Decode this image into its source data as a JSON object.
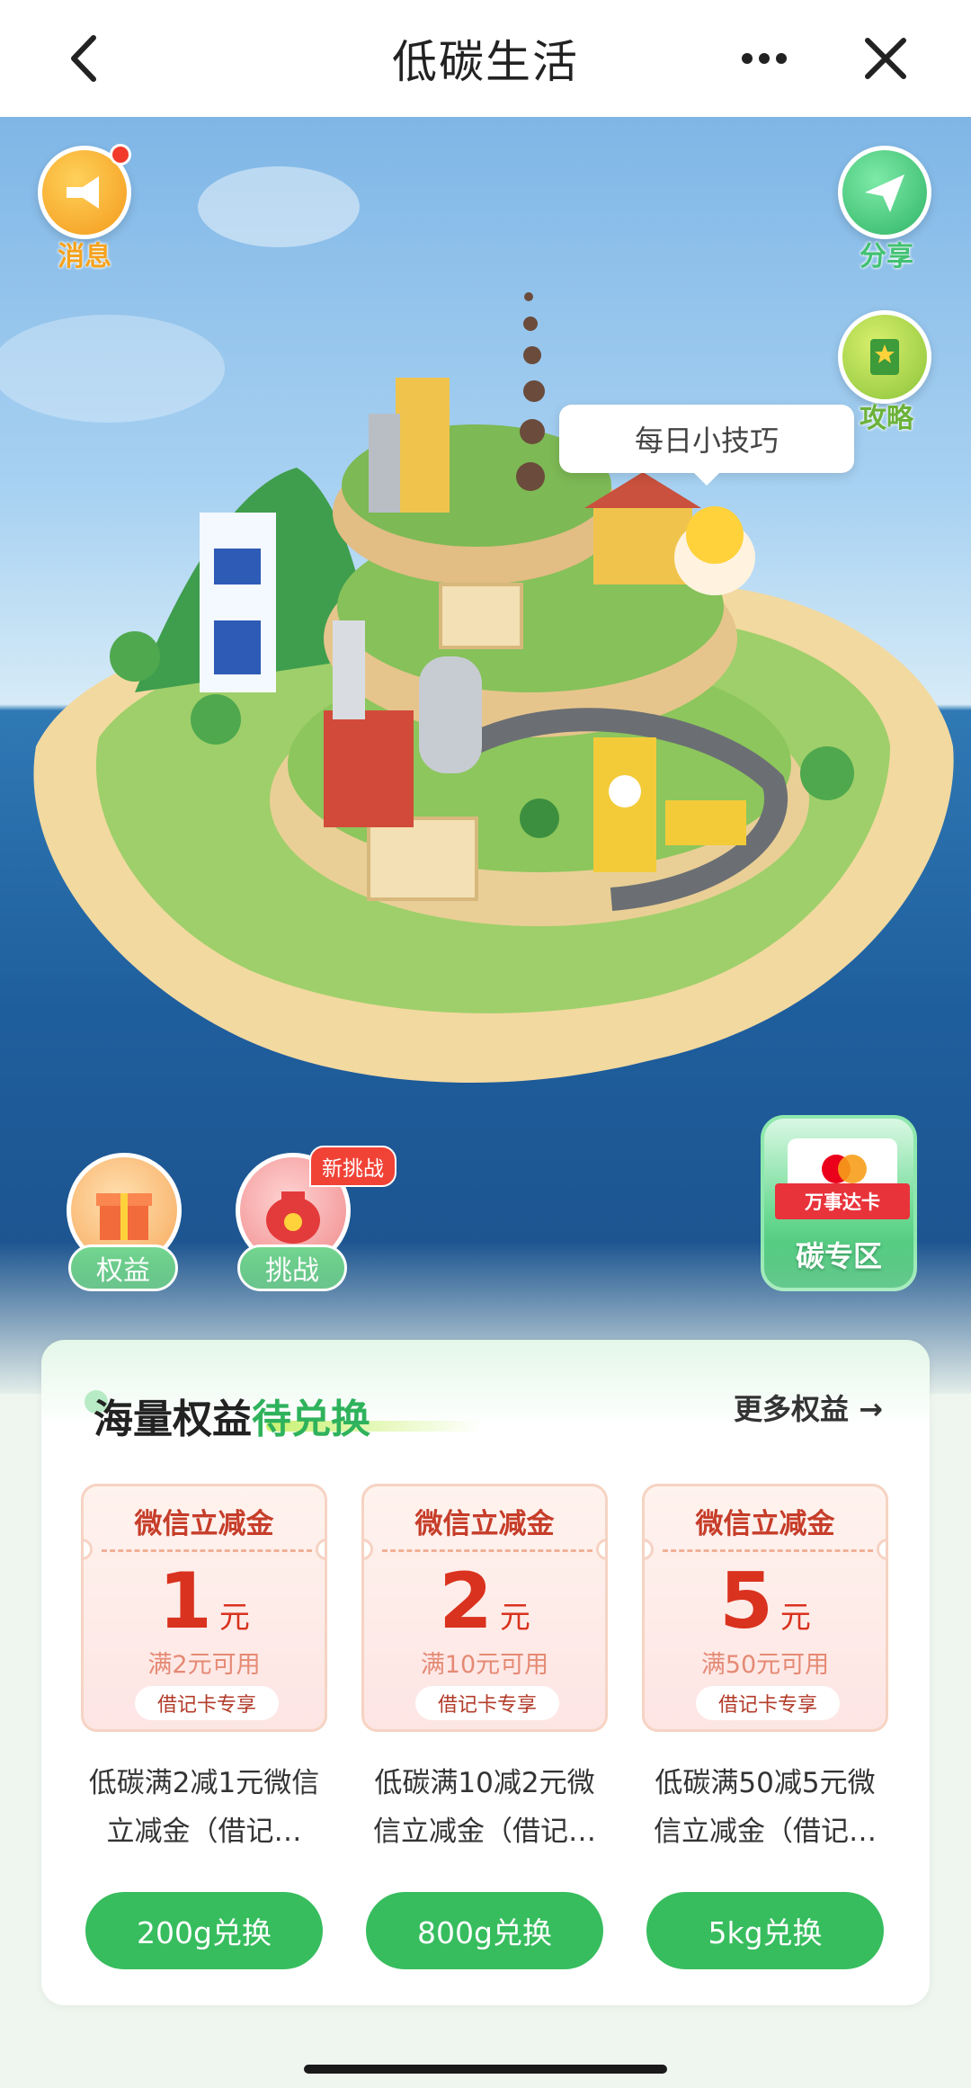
{
  "nav": {
    "title": "低碳生活",
    "back_icon": "chevron-left-icon",
    "more_icon": "ellipsis-icon",
    "close_icon": "close-icon"
  },
  "scene": {
    "message_label": "消息",
    "share_label": "分享",
    "guide_label": "攻略",
    "tip_bubble": "每日小技巧",
    "rights_label": "权益",
    "challenge_label": "挑战",
    "new_challenge_badge": "新挑战",
    "carbon_zone_ribbon": "万事达卡",
    "carbon_zone_title": "碳专区"
  },
  "rights_panel": {
    "title_plain": "海量权益",
    "title_highlight": "待兑换",
    "more_label": "更多权益 →",
    "cards": [
      {
        "coupon_title": "微信立减金",
        "amount": "1",
        "unit": "元",
        "condition": "满2元可用",
        "tag": "借记卡专享",
        "desc": "低碳满2减1元微信立减金（借记…",
        "button": "200g兑换"
      },
      {
        "coupon_title": "微信立减金",
        "amount": "2",
        "unit": "元",
        "condition": "满10元可用",
        "tag": "借记卡专享",
        "desc": "低碳满10减2元微信立减金（借记…",
        "button": "800g兑换"
      },
      {
        "coupon_title": "微信立减金",
        "amount": "5",
        "unit": "元",
        "condition": "满50元可用",
        "tag": "借记卡专享",
        "desc": "低碳满50减5元微信立减金（借记…",
        "button": "5kg兑换"
      }
    ]
  },
  "colors": {
    "accent_green": "#37bd5e",
    "coupon_red": "#d9321e",
    "badge_red": "#f14236"
  }
}
